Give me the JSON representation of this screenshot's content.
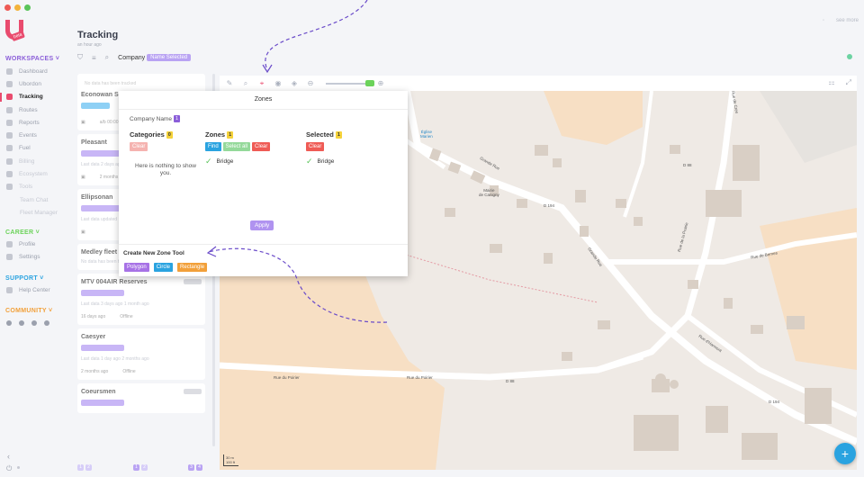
{
  "app": {
    "title": "Tracking",
    "subtitle": "an hour ago",
    "top_right_text": "see more"
  },
  "sidebar": {
    "logo_badge": "beta",
    "workspaces_label": "WORKSPACES",
    "items": [
      {
        "label": "Dashboard",
        "icon": "dashboard-icon",
        "state": "normal"
      },
      {
        "label": "Ubordon",
        "icon": "devices-icon",
        "state": "normal"
      },
      {
        "label": "Tracking",
        "icon": "location-pin-icon",
        "state": "active"
      },
      {
        "label": "Routes",
        "icon": "routes-icon",
        "state": "normal"
      },
      {
        "label": "Reports",
        "icon": "reports-icon",
        "state": "normal"
      },
      {
        "label": "Events",
        "icon": "events-icon",
        "state": "normal"
      },
      {
        "label": "Fuel",
        "icon": "fuel-icon",
        "state": "normal"
      },
      {
        "label": "Billing",
        "icon": "billing-icon",
        "state": "faded"
      },
      {
        "label": "Ecosystem",
        "icon": "ecosystem-icon",
        "state": "faded"
      },
      {
        "label": "Tools",
        "icon": "tools-icon",
        "state": "faded"
      },
      {
        "label": "Team Chat",
        "icon": "",
        "state": "sub"
      },
      {
        "label": "Fleet Manager",
        "icon": "",
        "state": "sub"
      }
    ],
    "career_label": "CAREER",
    "career_items": [
      {
        "label": "Profile",
        "icon": "profile-icon"
      },
      {
        "label": "Settings",
        "icon": "settings-icon"
      }
    ],
    "support_label": "SUPPORT",
    "support_items": [
      {
        "label": "Help Center",
        "icon": "help-icon"
      }
    ],
    "community_label": "COMMUNITY"
  },
  "filter": {
    "label": "Company",
    "chip": "Name Selected"
  },
  "list": {
    "cards": [
      {
        "hint": "No data has been tracked",
        "title": "Econowan S1",
        "tag": "blue",
        "text": "a/b 00:00",
        "meta": [
          "",
          ""
        ]
      },
      {
        "hint": "",
        "title": "Pleasant",
        "tag": "purple",
        "text": "Last data 2 days ago",
        "meta": [
          "2 months ago",
          ""
        ]
      },
      {
        "hint": "",
        "title": "Ellipsonan",
        "tag": "purple",
        "text": "Last data updated",
        "meta": [
          "",
          ""
        ]
      },
      {
        "hint": "",
        "title": "Medley fleet",
        "tag": "none",
        "text": "No data has been tracked",
        "meta": [
          "",
          ""
        ]
      },
      {
        "hint": "",
        "title": "MTV 004AIR Reserves",
        "tag": "purple",
        "text": "Last data 3 days ago 1 month ago",
        "meta": [
          "16 days ago",
          "Offline"
        ]
      },
      {
        "hint": "",
        "title": "Caesyer",
        "tag": "purple",
        "text": "Last data 1 day ago 2 months ago",
        "meta": [
          "2 months ago",
          "Offline"
        ]
      },
      {
        "hint": "",
        "title": "Coeursmen",
        "tag": "purple",
        "text": "",
        "meta": [
          "",
          ""
        ]
      }
    ],
    "pager": [
      "1",
      "2",
      "1",
      "2",
      "3",
      "4"
    ]
  },
  "dialog": {
    "title": "Zones",
    "company_label": "Company Name",
    "company_count": "1",
    "categories_label": "Categories",
    "categories_count": "0",
    "categories_clear": "Clear",
    "categories_empty": "Here is nothing to show you.",
    "zones_label": "Zones",
    "zones_count": "1",
    "zones_find": "Find",
    "zones_select_all": "Select all",
    "zones_clear": "Clear",
    "zones_items": [
      "Bridge"
    ],
    "selected_label": "Selected",
    "selected_count": "1",
    "selected_clear": "Clear",
    "selected_items": [
      "Bridge"
    ],
    "apply_label": "Apply",
    "create_title": "Create New Zone Tool",
    "polygon_label": "Polygon",
    "circle_label": "Circle",
    "rectangle_label": "Rectangle"
  },
  "map": {
    "labels": {
      "grande_rue": "Grande Rue",
      "rue_du_poirier_1": "Rue du Poirier",
      "rue_du_poirier_2": "Rue du Poirier",
      "rue_de_bernes": "Rue de Bernes",
      "d88_top": "D 88",
      "d88_bottom": "D 88",
      "d194_top": "D 194",
      "d194_bottom": "D 194",
      "mairie": "Mairie\nde Canigny",
      "eglise": "Église\nMarien",
      "grande_rue_2": "Grande Rue",
      "rue_prairie": "Rue de la Prairie",
      "rue_de_cres": "Rue de Crès",
      "rue_charmont": "Rue d'Harmont"
    },
    "scale_m": "30 m",
    "scale_ft": "100 ft"
  },
  "colors": {
    "accent": "#e94b6e",
    "purple": "#b093f0",
    "blue": "#2aa3e0",
    "red": "#ef5b55",
    "orange": "#f2a03a",
    "green": "#5ac45a"
  }
}
